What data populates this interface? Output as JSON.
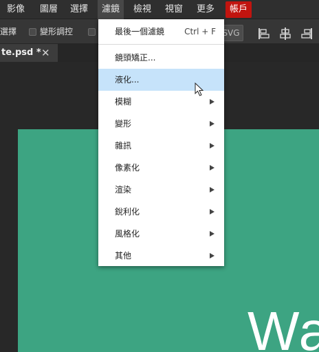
{
  "menubar": {
    "items": [
      {
        "label": "影像"
      },
      {
        "label": "圖層"
      },
      {
        "label": "選擇"
      },
      {
        "label": "濾鏡"
      },
      {
        "label": "檢視"
      },
      {
        "label": "視窗"
      },
      {
        "label": "更多"
      }
    ],
    "account_label": "帳戶",
    "account_color": "#c1140f"
  },
  "toolbar": {
    "partial_label": "選擇",
    "transform_controls_label": "變形調控",
    "svg_label": "SVG"
  },
  "document": {
    "tab_title": "te.psd *",
    "close_glyph": "✕",
    "canvas_text": "Wa",
    "canvas_color": "#3da482"
  },
  "filter_menu": {
    "last_filter": {
      "label": "最後一個濾鏡",
      "shortcut": "Ctrl + F"
    },
    "items": [
      {
        "label": "鏡頭矯正..."
      },
      {
        "label": "液化..."
      },
      {
        "label": "模糊"
      },
      {
        "label": "變形"
      },
      {
        "label": "雜訊"
      },
      {
        "label": "像素化"
      },
      {
        "label": "渲染"
      },
      {
        "label": "銳利化"
      },
      {
        "label": "風格化"
      },
      {
        "label": "其他"
      }
    ],
    "highlight_color": "#c6e3fa"
  }
}
